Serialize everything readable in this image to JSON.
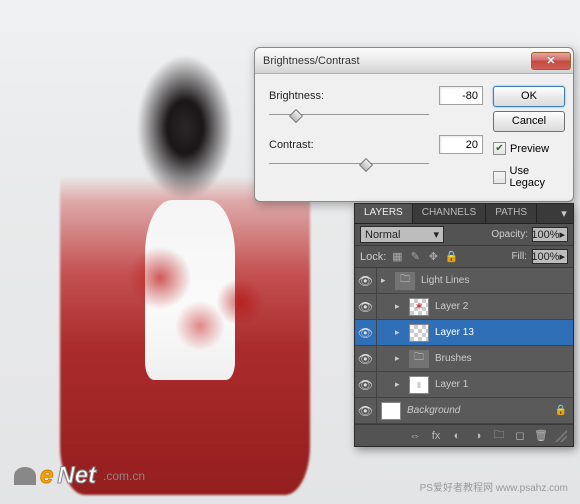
{
  "dialog": {
    "title": "Brightness/Contrast",
    "brightness": {
      "label": "Brightness:",
      "value": "-80",
      "pos": 22
    },
    "contrast": {
      "label": "Contrast:",
      "value": "20",
      "pos": 92
    },
    "buttons": {
      "ok": "OK",
      "cancel": "Cancel"
    },
    "preview": {
      "label": "Preview",
      "checked": true
    },
    "legacy": {
      "label": "Use Legacy",
      "checked": false
    }
  },
  "layers": {
    "tabs": [
      "LAYERS",
      "CHANNELS",
      "PATHS"
    ],
    "blend_mode": "Normal",
    "opacity": {
      "label": "Opacity:",
      "value": "100%"
    },
    "lock": {
      "label": "Lock:"
    },
    "fill": {
      "label": "Fill:",
      "value": "100%"
    },
    "items": [
      {
        "name": "Light Lines",
        "type": "group",
        "visible": true
      },
      {
        "name": "Layer 2",
        "type": "layer",
        "visible": true,
        "indent": true
      },
      {
        "name": "Layer 13",
        "type": "layer",
        "visible": true,
        "selected": true,
        "indent": true
      },
      {
        "name": "Brushes",
        "type": "group",
        "visible": true,
        "indent": true
      },
      {
        "name": "Layer 1",
        "type": "layer",
        "visible": true,
        "indent": true
      },
      {
        "name": "Background",
        "type": "bg",
        "visible": true,
        "locked": true
      }
    ]
  },
  "branding": {
    "e": "e",
    "net": "Net",
    "cn": ".com.cn"
  },
  "footer": "PS爱好者教程网   www.psahz.com"
}
